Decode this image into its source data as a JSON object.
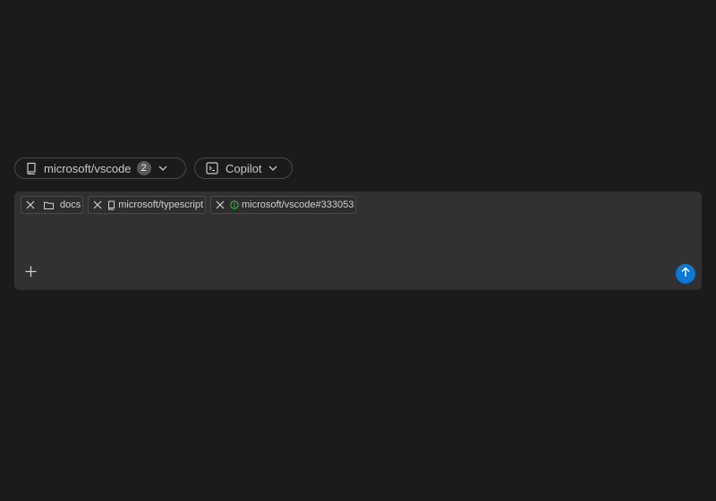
{
  "header": {
    "repo_pill": {
      "label": "microsoft/vscode",
      "count": "2",
      "icon": "repo-icon"
    },
    "agent_pill": {
      "label": "Copilot",
      "icon": "terminal-icon"
    }
  },
  "composer": {
    "attachments": [
      {
        "label": "docs",
        "icon": "folder-icon"
      },
      {
        "label": "microsoft/typescript",
        "icon": "repo-icon"
      },
      {
        "label": "microsoft/vscode#333053",
        "icon": "issue-icon"
      }
    ],
    "add_icon": "plus-icon",
    "send_icon": "arrow-up-icon"
  },
  "colors": {
    "background": "#1b1b1b",
    "composer_bg": "#313131",
    "accent": "#0b78d4",
    "issue_green": "#3fb950"
  }
}
